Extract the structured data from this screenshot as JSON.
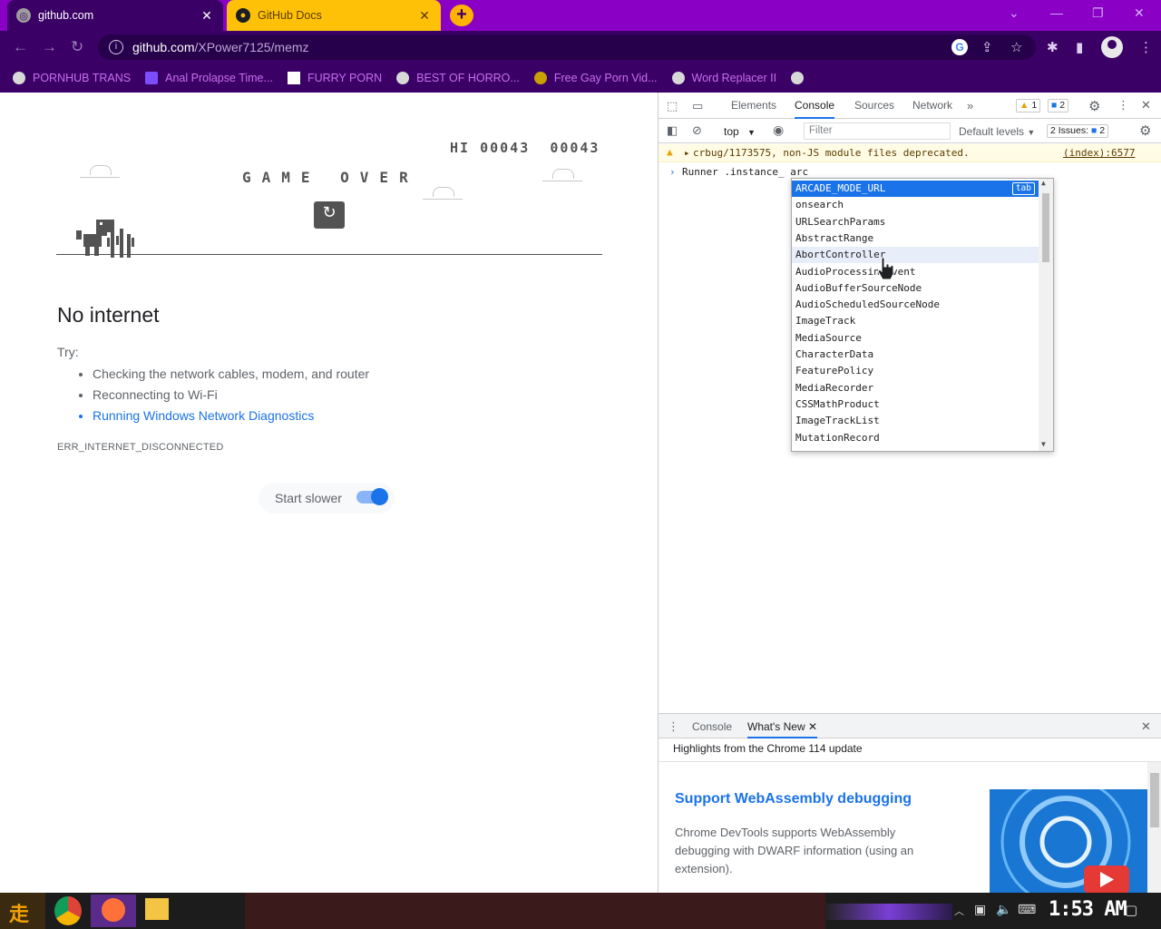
{
  "tabs": [
    {
      "title": "github.com",
      "active": true
    },
    {
      "title": "GitHub Docs",
      "active": false
    }
  ],
  "new_tab": "+",
  "omnibox": {
    "host": "github.com",
    "path": "/XPower7125/memz"
  },
  "bookmarks": [
    "PORNHUB TRANS",
    "Anal Prolapse Time...",
    "FURRY PORN",
    "BEST OF HORRO...",
    "Free Gay Porn Vid...",
    "Word Replacer II"
  ],
  "game": {
    "hi_label": "HI",
    "hi_score": "00043",
    "score": "00043",
    "game_over": "GAME OVER"
  },
  "error_page": {
    "heading": "No internet",
    "try_label": "Try:",
    "tips": [
      "Checking the network cables, modem, and router",
      "Reconnecting to Wi-Fi",
      "Running Windows Network Diagnostics"
    ],
    "error_code": "ERR_INTERNET_DISCONNECTED",
    "start_slower_label": "Start slower",
    "start_slower_on": true
  },
  "devtools": {
    "tabs": [
      "Elements",
      "Console",
      "Sources",
      "Network"
    ],
    "selected_tab": "Console",
    "warn_count": "1",
    "msg_count": "2",
    "context": "top",
    "filter_placeholder": "Filter",
    "levels": "Default levels",
    "issues_label": "2 Issues:",
    "issues_count": "2",
    "warning_text": "crbug/1173575, non-JS module files deprecated.",
    "warning_source": "(index):6577",
    "prompt_text": "Runner .instance_ arc",
    "autocomplete": [
      "ARCADE_MODE_URL",
      "onsearch",
      "URLSearchParams",
      "AbstractRange",
      "AbortController",
      "AudioProcessingEvent",
      "AudioBufferSourceNode",
      "AudioScheduledSourceNode",
      "ImageTrack",
      "MediaSource",
      "CharacterData",
      "FeaturePolicy",
      "MediaRecorder",
      "CSSMathProduct",
      "ImageTrackList",
      "MutationRecord"
    ],
    "tab_hint": "tab",
    "drawer_tabs": [
      "Console",
      "What's New"
    ],
    "whats_new_header": "Highlights from the Chrome 114 update",
    "whats_new_title": "Support WebAssembly debugging",
    "whats_new_desc": "Chrome DevTools supports WebAssembly debugging with DWARF information (using an extension)."
  },
  "taskbar": {
    "clock": "1:53 AM"
  },
  "colors": {
    "tabstrip": "#8a00c4",
    "toolbar": "#3b0066",
    "bookmark_text": "#c86ff0",
    "accent": "#1a73e8"
  }
}
